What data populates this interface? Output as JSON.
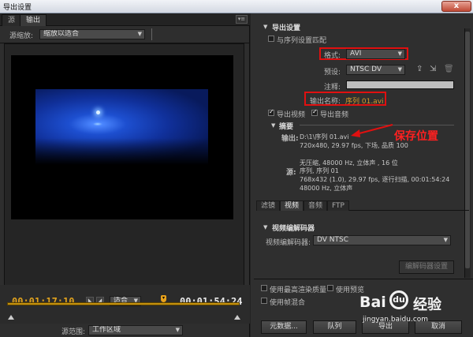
{
  "window": {
    "title": "导出设置",
    "close_glyph": "x"
  },
  "left": {
    "tabs": [
      {
        "label": "源",
        "active": false
      },
      {
        "label": "输出",
        "active": true
      }
    ],
    "menu_glyph": "▾≡",
    "source_scale_label": "源缩放:",
    "source_scale_value": "缩放以适合",
    "current_timecode": "00:01:17:10",
    "fit_value": "适合",
    "duration_timecode": "00:01:54:24",
    "source_range_label": "源范围:",
    "source_range_value": "工作区域"
  },
  "right": {
    "export_settings_title": "导出设置",
    "match_sequence_label": "与序列设置匹配",
    "format_label": "格式:",
    "format_value": "AVI",
    "preset_label": "预设:",
    "preset_value": "NTSC DV",
    "comments_label": "注释:",
    "output_name_label": "输出名称:",
    "output_name_value": "序列 01.avi",
    "export_video_label": "导出视频",
    "export_audio_label": "导出音频",
    "summary_title": "摘要",
    "output_label": "输出:",
    "output_lines": [
      "D:\\1\\序列 01.avi",
      "720x480, 29.97 fps, 下场, 品质 100",
      "",
      "无压缩, 48000 Hz, 立体声 , 16 位"
    ],
    "source_label": "源:",
    "source_lines": [
      "序列, 序列 01",
      "768x432 (1.0), 29.97 fps, 逐行扫描, 00:01:54:24",
      "48000 Hz, 立体声"
    ],
    "annotation": "保存位置",
    "subtabs": [
      {
        "label": "滤镜",
        "active": false
      },
      {
        "label": "视频",
        "active": true
      },
      {
        "label": "音频",
        "active": false
      },
      {
        "label": "FTP",
        "active": false
      }
    ],
    "video_codec_title": "视频编解码器",
    "video_codec_label": "视频编解码器:",
    "video_codec_value": "DV NTSC",
    "codec_settings_label": "编解码器设置",
    "max_render_quality_label": "使用最高渲染质量",
    "use_preview_label": "使用预览",
    "frame_blending_label": "使用帧混合",
    "buttons": {
      "metadata": "元数据...",
      "queue": "队列",
      "export": "导出",
      "cancel": "取消"
    }
  },
  "watermark": {
    "brand": "Bai",
    "brand2": "经验",
    "url": "jingyan.baidu.com"
  },
  "colors": {
    "timecode": "#e0a21e",
    "highlight": "#e01010",
    "track": "#c4900e"
  }
}
